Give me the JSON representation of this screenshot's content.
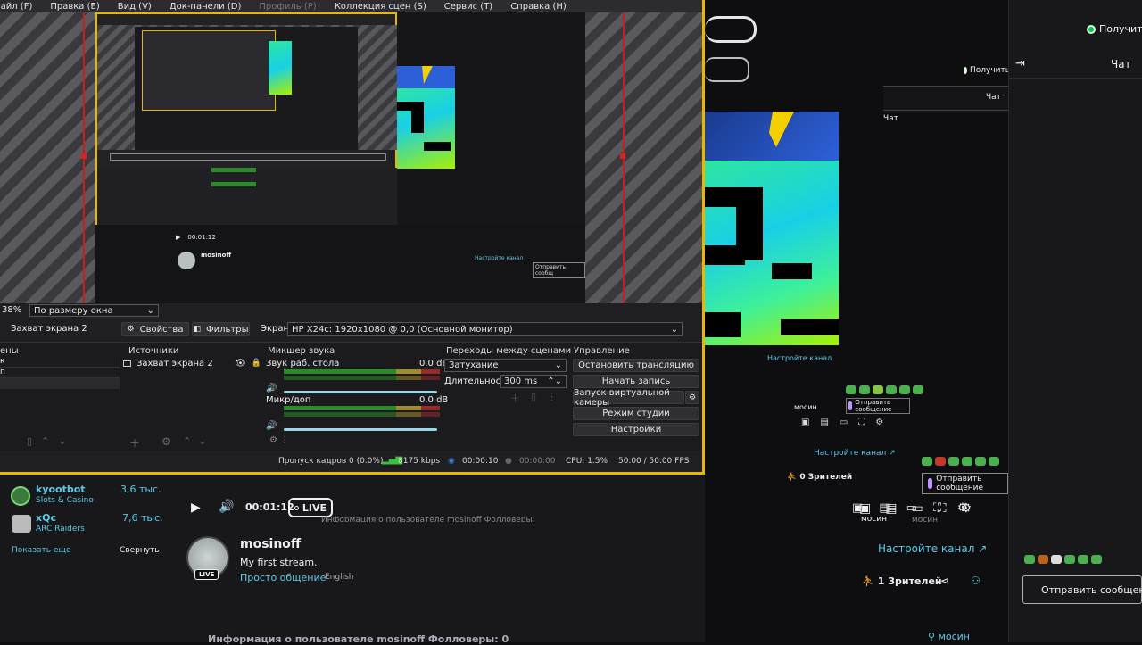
{
  "obs": {
    "menu": [
      "Файл (F)",
      "Правка (E)",
      "Вид (V)",
      "Док-панели (D)",
      "Профиль (P)",
      "Коллекция сцен (S)",
      "Сервис (T)",
      "Справка (H)"
    ],
    "zoom_percent": "38%",
    "zoom_mode": "По размеру окна",
    "selected_source": "Захват экрана 2",
    "properties_label": "Свойства",
    "filters_label": "Фильтры",
    "screen_label": "Экран",
    "screen_value": "HP X24c: 1920x1080 @ 0,0 (Основной монитор)",
    "scenes_title": "ены",
    "sources_title": "Источники",
    "source_item": "Захват экрана 2",
    "mixer_title": "Микшер звука",
    "mixer_channels": [
      {
        "name": "Звук раб. стола",
        "db": "0.0 dB"
      },
      {
        "name": "Микр/доп",
        "db": "0.0 dB"
      }
    ],
    "transitions_title": "Переходы между сценами",
    "transition_value": "Затухание",
    "duration_label": "Длительность",
    "duration_value": "300 ms",
    "controls_title": "Управление",
    "controls": [
      "Остановить трансляцию",
      "Начать запись",
      "Запуск виртуальной камеры",
      "Режим студии",
      "Настройки"
    ],
    "status": {
      "dropped": "Пропуск кадров 0 (0.0%)",
      "bitrate": "8175 kbps",
      "live_time": "00:00:10",
      "rec_time": "00:00:00",
      "cpu": "CPU: 1.5%",
      "fps": "50.00 / 50.00 FPS"
    }
  },
  "twitch": {
    "recommended": [
      {
        "name": "kyootbot",
        "game": "Slots & Casino",
        "viewers": "3,6 тыс."
      },
      {
        "name": "xQc",
        "game": "ARC Raiders",
        "viewers": "7,6 тыс."
      }
    ],
    "show_more": "Показать еще",
    "collapse": "Свернуть",
    "player_time": "00:01:12",
    "live_label": "LIVE",
    "avatar_live": "LIVE",
    "channel_name": "mosinoff",
    "stream_title": "My first stream.",
    "category": "Просто общение",
    "language": "English",
    "setup_channel": "Настройте канал",
    "viewers": "1 Зрителей",
    "about_text": "Информация о пользователе mosinoff  Фолловеры: 0",
    "chat_title": "Чат",
    "get_label": "Получить",
    "send_message": "Отправить сообщение",
    "footer_user": "мосин",
    "preview_setup": "Настройте канал",
    "preview_viewers": "0 Зрителей",
    "preview_get": "Получить",
    "preview_chat": "Чат",
    "preview_send": "Отправить сообщение",
    "preview_user": "мосин"
  },
  "colors": {
    "obs_border": "#e8b800",
    "twitch_purple": "#bf94ff",
    "twitch_teal": "#5ec8e5",
    "live_green": "#00c853"
  }
}
